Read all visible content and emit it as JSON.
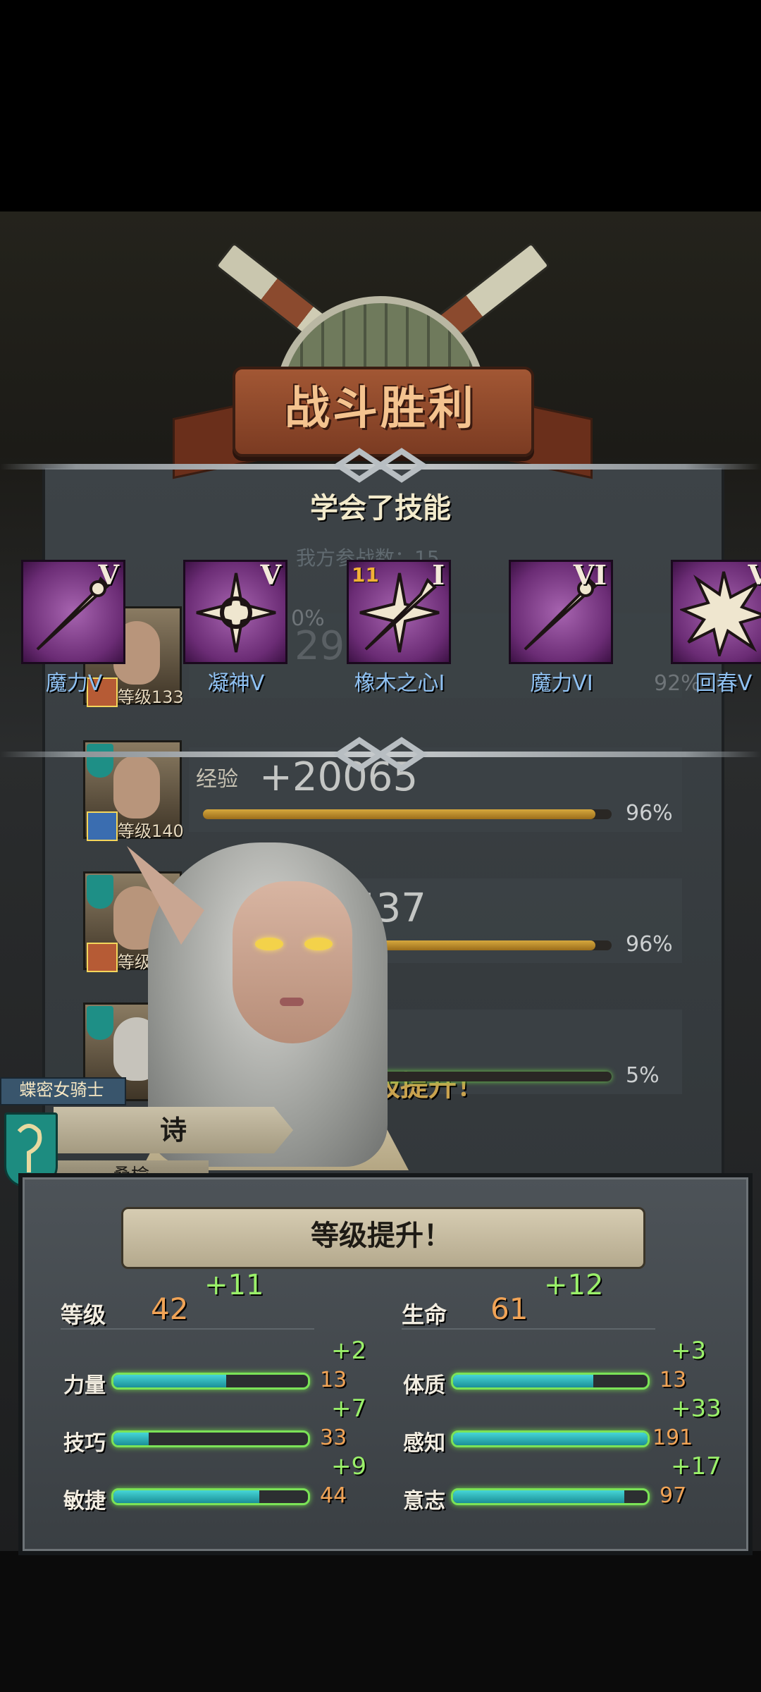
{
  "header": {
    "victory_title": "战斗胜利",
    "skills_heading": "学会了技能",
    "team_count_ghost": "我方参战数：15"
  },
  "skills": [
    {
      "name": "魔力V",
      "roman": "V",
      "icon": "staff-icon"
    },
    {
      "name": "凝神V",
      "roman": "V",
      "icon": "focus-cross-icon"
    },
    {
      "name": "橡木之心I",
      "roman": "I",
      "icon": "oak-heart-icon",
      "badge": "11"
    },
    {
      "name": "魔力VI",
      "roman": "VI",
      "icon": "staff-icon"
    },
    {
      "name": "回春V",
      "roman": "V",
      "icon": "burst-icon"
    }
  ],
  "roster": [
    {
      "level": "等级133",
      "exp_label": "",
      "exp_value": "29",
      "pct_text": "92%",
      "pct": 0.92,
      "pct_left": "0%"
    },
    {
      "level": "等级140",
      "exp_label": "经验",
      "exp_value": "+20065",
      "pct_text": "96%",
      "pct": 0.96
    },
    {
      "level": "等级15",
      "exp_label": "",
      "exp_value": "537",
      "pct_text": "96%",
      "pct": 0.96
    },
    {
      "level": "",
      "exp_label": "",
      "exp_value": "0",
      "pct_text": "5%",
      "pct": 0.05,
      "levelup_ghost": "级提升！"
    }
  ],
  "character": {
    "class": "蝶密女骑士",
    "name": "诗",
    "subtitle": "桑榆"
  },
  "level_up": {
    "title": "等级提升！",
    "level": {
      "label": "等级",
      "value": "42",
      "gain": "+11"
    },
    "hp": {
      "label": "生命",
      "value": "61",
      "gain": "+12"
    },
    "stats": [
      {
        "label": "力量",
        "value": "13",
        "gain": "+2",
        "fill": 0.58
      },
      {
        "label": "体质",
        "value": "13",
        "gain": "+3",
        "fill": 0.72
      },
      {
        "label": "技巧",
        "value": "33",
        "gain": "+7",
        "fill": 0.18
      },
      {
        "label": "感知",
        "value": "191",
        "gain": "+33",
        "fill": 1.0
      },
      {
        "label": "敏捷",
        "value": "44",
        "gain": "+9",
        "fill": 0.75
      },
      {
        "label": "意志",
        "value": "97",
        "gain": "+17",
        "fill": 0.88
      }
    ]
  },
  "colors": {
    "accent_green": "#9af06a",
    "stat_orange": "#f0a356",
    "skill_name_blue": "#8fc1f2",
    "title_gold": "#f4c38f"
  }
}
